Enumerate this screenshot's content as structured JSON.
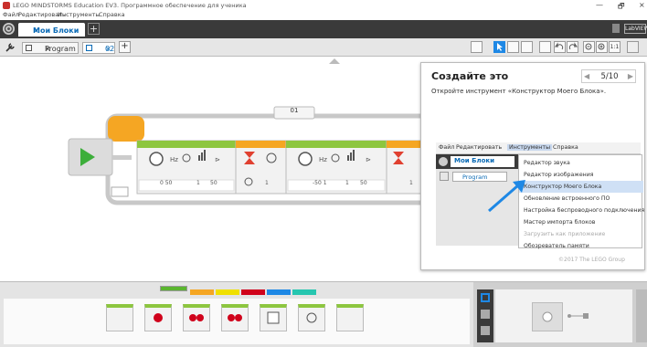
{
  "window": {
    "title": "LEGO MINDSTORMS Education EV3. Программное обеспечение для ученика",
    "minimize_glyph": "—",
    "maximize_glyph": "🗗",
    "close_glyph": "×"
  },
  "menubar": {
    "items": [
      "Файл",
      "Редактировать",
      "Инструменты",
      "Справка"
    ]
  },
  "project_bar": {
    "tab_label": "Мои Блоки",
    "tab_close": "×",
    "add_glyph": "+",
    "right_label": "LabVIEW"
  },
  "program_bar": {
    "tab1_label": "Program",
    "tab1_close": "×",
    "tab2_label": "02",
    "tab2_close": "×",
    "add_glyph": "+",
    "zoom_label": "1:1"
  },
  "canvas": {
    "loop_label": "01",
    "blocks": [
      {
        "ports": "",
        "value1": "",
        "value2": "",
        "value3": ""
      },
      {
        "ports": "",
        "value1": "0 50",
        "value2": "1",
        "value3": "50"
      },
      {
        "ports": "",
        "value1": "1",
        "value2": "",
        "value3": ""
      },
      {
        "ports": "",
        "value1": "-50 1",
        "value2": "1",
        "value3": "50"
      },
      {
        "ports": "",
        "value1": "1",
        "value2": "",
        "value3": ""
      }
    ]
  },
  "overlay": {
    "title": "Создайте это",
    "page": "5/10",
    "instruction": "Откройте инструмент «Конструктор Моего Блока».",
    "menu_items": [
      "Файл",
      "Редактировать",
      "Инструменты",
      "Справка"
    ],
    "tab_label": "Мои Блоки",
    "prog_tab_label": "Program",
    "dropdown": [
      "Редактор звука",
      "Редактор изображения",
      "Конструктор Моего Блока",
      "Обновление встроенного ПО",
      "Настройка беспроводного подключения",
      "Мастер импорта блоков",
      "Загрузить как приложение",
      "Обозреватель памяти"
    ],
    "copyright": "©2017 The LEGO Group"
  },
  "palette": {
    "tab_colors": [
      "#5ab52f",
      "#f5a623",
      "#f0e000",
      "#d0021b",
      "#1e88e5",
      "#26c6b0"
    ],
    "block_count": 7
  },
  "colors": {
    "dark_bar": "#3a3a3a",
    "accent_blue": "#0a6ab5",
    "green_block": "#8dc63f",
    "loop_orange": "#f5a623",
    "timer_red": "#e04030"
  }
}
